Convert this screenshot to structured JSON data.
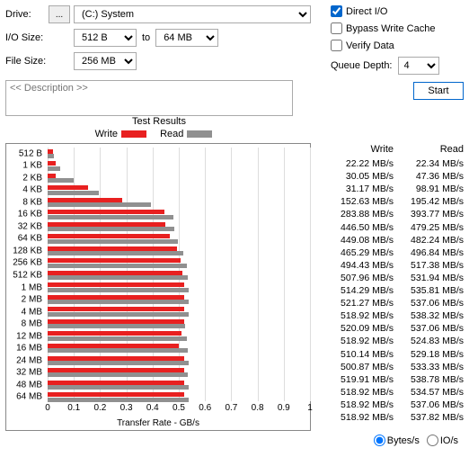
{
  "labels": {
    "drive": "Drive:",
    "drive_btn": "...",
    "drive_sel": "(C:) System",
    "io_size": "I/O Size:",
    "io_from": "512 B",
    "io_to_word": "to",
    "io_to": "64 MB",
    "file_size": "File Size:",
    "file_size_val": "256 MB",
    "direct_io": "Direct I/O",
    "bypass": "Bypass Write Cache",
    "verify": "Verify Data",
    "queue_depth": "Queue Depth:",
    "qd_val": "4",
    "desc_placeholder": "<< Description >>",
    "start": "Start",
    "test_results": "Test Results",
    "leg_write": "Write",
    "leg_read": "Read",
    "xaxis": "Transfer Rate - GB/s",
    "bytes": "Bytes/s",
    "ios": "IO/s"
  },
  "chart_data": {
    "type": "bar",
    "orientation": "horizontal",
    "xlabel": "Transfer Rate - GB/s",
    "ylabel": "",
    "xlim": [
      0,
      1
    ],
    "xticks": [
      0,
      0.1,
      0.2,
      0.3,
      0.4,
      0.5,
      0.6,
      0.7,
      0.8,
      0.9,
      1
    ],
    "categories": [
      "512 B",
      "1 KB",
      "2 KB",
      "4 KB",
      "8 KB",
      "16 KB",
      "32 KB",
      "64 KB",
      "128 KB",
      "256 KB",
      "512 KB",
      "1 MB",
      "2 MB",
      "4 MB",
      "8 MB",
      "12 MB",
      "16 MB",
      "24 MB",
      "32 MB",
      "48 MB",
      "64 MB"
    ],
    "series": [
      {
        "name": "Write",
        "color": "#e82020",
        "values": [
          22.22,
          30.05,
          31.17,
          152.63,
          283.88,
          446.5,
          449.08,
          465.29,
          494.43,
          507.96,
          514.29,
          521.27,
          518.92,
          520.09,
          518.92,
          510.14,
          500.87,
          519.91,
          518.92,
          518.92,
          518.92
        ]
      },
      {
        "name": "Read",
        "color": "#909090",
        "values": [
          22.34,
          47.36,
          98.91,
          195.42,
          393.77,
          479.25,
          482.24,
          496.84,
          517.38,
          531.94,
          535.81,
          537.06,
          538.32,
          537.06,
          524.83,
          529.18,
          533.33,
          538.78,
          534.57,
          537.06,
          537.82
        ]
      }
    ],
    "unit_display": "MB/s"
  },
  "columns": {
    "write": "Write",
    "read": "Read"
  }
}
